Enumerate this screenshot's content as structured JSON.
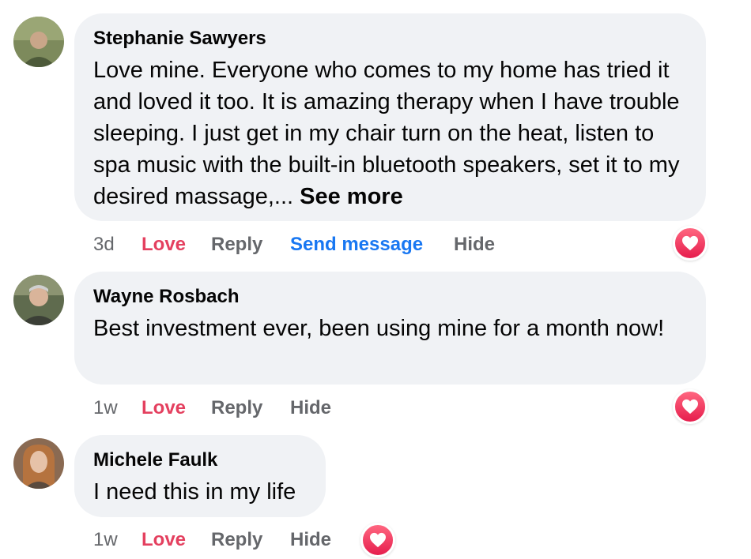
{
  "comments": [
    {
      "author": "Stephanie Sawyers",
      "text": "Love mine. Everyone who comes to my home has tried it and loved it too. It is amazing therapy when I have trouble sleeping. I just get in my chair turn on the heat, listen to spa music with the built-in bluetooth speakers, set it to my desired massage,... ",
      "see_more": "See more",
      "time": "3d",
      "love_label": "Love",
      "reply_label": "Reply",
      "send_message_label": "Send message",
      "hide_label": "Hide",
      "reaction_icon": "love-reaction-icon"
    },
    {
      "author": "Wayne Rosbach",
      "text": "Best investment ever, been using mine for a month now!",
      "time": "1w",
      "love_label": "Love",
      "reply_label": "Reply",
      "hide_label": "Hide",
      "reaction_icon": "love-reaction-icon"
    },
    {
      "author": "Michele Faulk",
      "text": "I need this in my life",
      "time": "1w",
      "love_label": "Love",
      "reply_label": "Reply",
      "hide_label": "Hide",
      "reaction_icon": "love-reaction-icon"
    }
  ],
  "colors": {
    "bubble": "#f0f2f5",
    "love": "#e4405f",
    "link_blue": "#1877f2",
    "muted": "#65676b"
  }
}
